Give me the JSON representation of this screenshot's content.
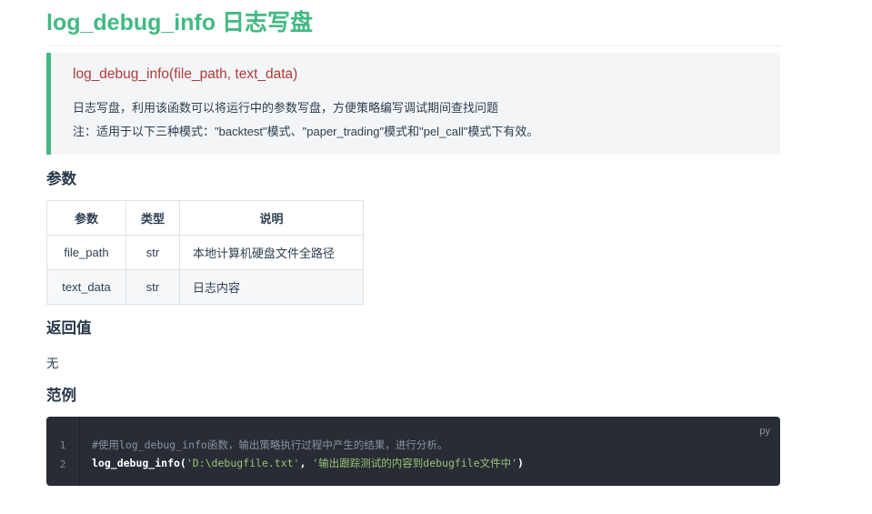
{
  "title": "log_debug_info 日志写盘",
  "tip": {
    "signature": "log_debug_info(file_path, text_data)",
    "description": "日志写盘，利用该函数可以将运行中的参数写盘，方便策略编写调试期间查找问题",
    "note": "注：适用于以下三种模式：\"backtest\"模式、\"paper_trading\"模式和\"pel_call\"模式下有效。"
  },
  "params_section": {
    "heading": "参数",
    "columns": [
      "参数",
      "类型",
      "说明"
    ],
    "rows": [
      {
        "name": "file_path",
        "type": "str",
        "desc": "本地计算机硬盘文件全路径"
      },
      {
        "name": "text_data",
        "type": "str",
        "desc": "日志内容"
      }
    ]
  },
  "return_section": {
    "heading": "返回值",
    "value": "无"
  },
  "example_section": {
    "heading": "范例",
    "language": "py",
    "line_numbers": [
      "1",
      "2"
    ],
    "line1_comment": "#使用log_debug_info函数，输出策略执行过程中产生的结果，进行分析。",
    "line2_call": "log_debug_info(",
    "line2_arg1": "'D:\\debugfile.txt'",
    "line2_sep": ", ",
    "line2_arg2": "'输出跟踪测试的内容到debugfile文件中'",
    "line2_close": ")"
  }
}
